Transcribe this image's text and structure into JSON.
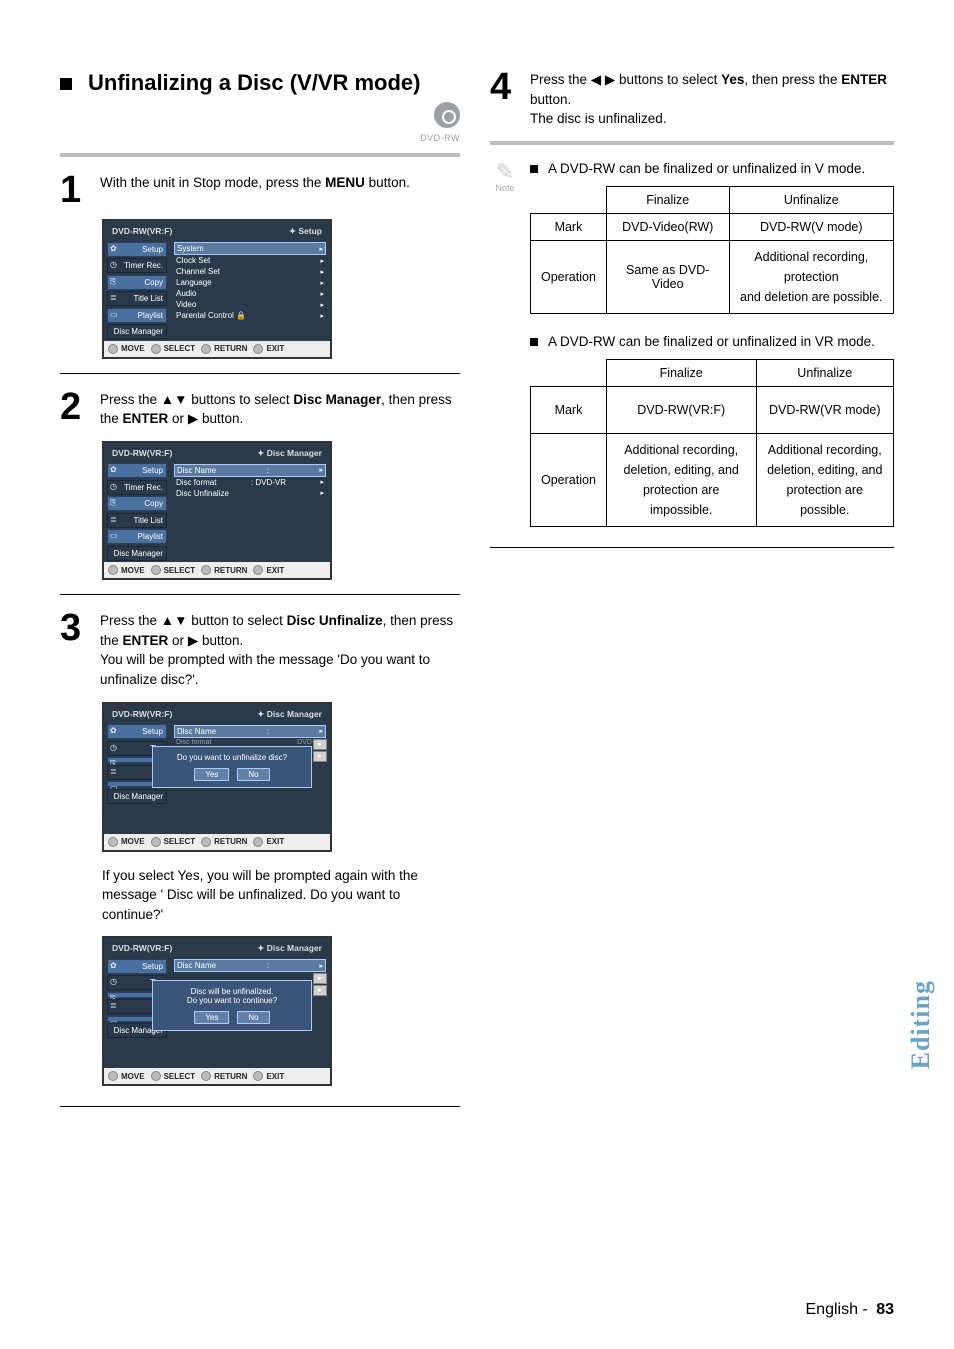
{
  "heading": {
    "title": "Unfinalizing a Disc (V/VR mode)",
    "disc_badge_label": "DVD-RW"
  },
  "steps": {
    "s1": {
      "num": "1",
      "text_pre": "With the unit in Stop mode, press the ",
      "text_bold": "MENU",
      "text_post": " button."
    },
    "s2": {
      "num": "2",
      "text_pre": "Press the ",
      "arrows": "▲▼",
      "text_mid": " buttons to select ",
      "text_bold": "Disc Manager",
      "text_post": ", then press the ",
      "text_bold2": "ENTER",
      "text_or": " or ",
      "arrow_r": "▶",
      "text_end": " button."
    },
    "s3": {
      "num": "3",
      "line1_pre": "Press the ",
      "arrows": "▲▼",
      "line1_mid": " button to select ",
      "line1_bold": "Disc Unfinalize",
      "line1_post": ", then press the ",
      "line1_bold2": "ENTER",
      "line1_or": " or ",
      "arrow_r": "▶",
      "line1_end": " button.",
      "line2": "You will be prompted with the message 'Do you want to unfinalize disc?'.",
      "confirm_text": "If you select Yes, you will be prompted again with the message ' Disc will be unfinalized. Do you want to continue?'"
    },
    "s4": {
      "num": "4",
      "text_pre": "Press the ",
      "arrows": "◀ ▶",
      "text_mid": " buttons to select ",
      "text_bold": "Yes",
      "text_post": ", then press the ",
      "text_bold2": "ENTER",
      "text_post2": " button.",
      "line2": "The disc is unfinalized."
    }
  },
  "osd": {
    "header_mode": "DVD-RW(VR:F)",
    "header_setup": "Setup",
    "header_discmgr": "Disc Manager",
    "footer": {
      "move": "MOVE",
      "select": "SELECT",
      "return": "RETURN",
      "exit": "EXIT"
    },
    "sidebar": {
      "setup": "Setup",
      "timer": "Timer Rec.",
      "copy": "Copy",
      "titlelist": "Title List",
      "playlist": "Playlist",
      "discmgr": "Disc Manager",
      "ti_short": "Ti",
      "tim_short": "Tim"
    },
    "menu1": {
      "system": "System",
      "clock": "Clock Set",
      "channel": "Channel Set",
      "language": "Language",
      "audio": "Audio",
      "video": "Video",
      "parental": "Parental Control"
    },
    "menu2": {
      "discname": "Disc Name",
      "discname_val": ":",
      "discformat": "Disc format",
      "discformat_val": ": DVD-VR",
      "discunfinal": "Disc Unfinalize"
    },
    "dialog1": {
      "msg": "Do you want to unfinalize disc?",
      "yes": "Yes",
      "no": "No"
    },
    "dialog2": {
      "msg1": "Disc will be unfinalized.",
      "msg2": "Do you want to continue?",
      "yes": "Yes",
      "no": "No"
    },
    "dvdvr_short": "DVD-VR"
  },
  "notes": {
    "note_label": "Note",
    "n1": "A DVD-RW can be finalized or unfinalized in V mode.",
    "n2": "A DVD-RW can be finalized or unfinalized in VR mode."
  },
  "table1": {
    "h_finalize": "Finalize",
    "h_unfinalize": "Unfinalize",
    "r_mark": "Mark",
    "r_mark_fin": "DVD-Video(RW)",
    "r_mark_unfin": "DVD-RW(V mode)",
    "r_op": "Operation",
    "r_op_fin": "Same as DVD-Video",
    "r_op_unfin_l1": "Additional recording, protection",
    "r_op_unfin_l2": "and deletion are possible."
  },
  "table2": {
    "h_finalize": "Finalize",
    "h_unfinalize": "Unfinalize",
    "r_mark": "Mark",
    "r_mark_fin": "DVD-RW(VR:F)",
    "r_mark_unfin": "DVD-RW(VR mode)",
    "r_op": "Operation",
    "r_op_fin_l1": "Additional recording,",
    "r_op_fin_l2": "deletion, editing, and",
    "r_op_fin_l3": "protection are impossible.",
    "r_op_unfin_l1": "Additional recording,",
    "r_op_unfin_l2": "deletion, editing, and",
    "r_op_unfin_l3": "protection are possible."
  },
  "footer": {
    "lang": "English",
    "sep": " - ",
    "page": "83"
  },
  "sidetab": "Editing"
}
